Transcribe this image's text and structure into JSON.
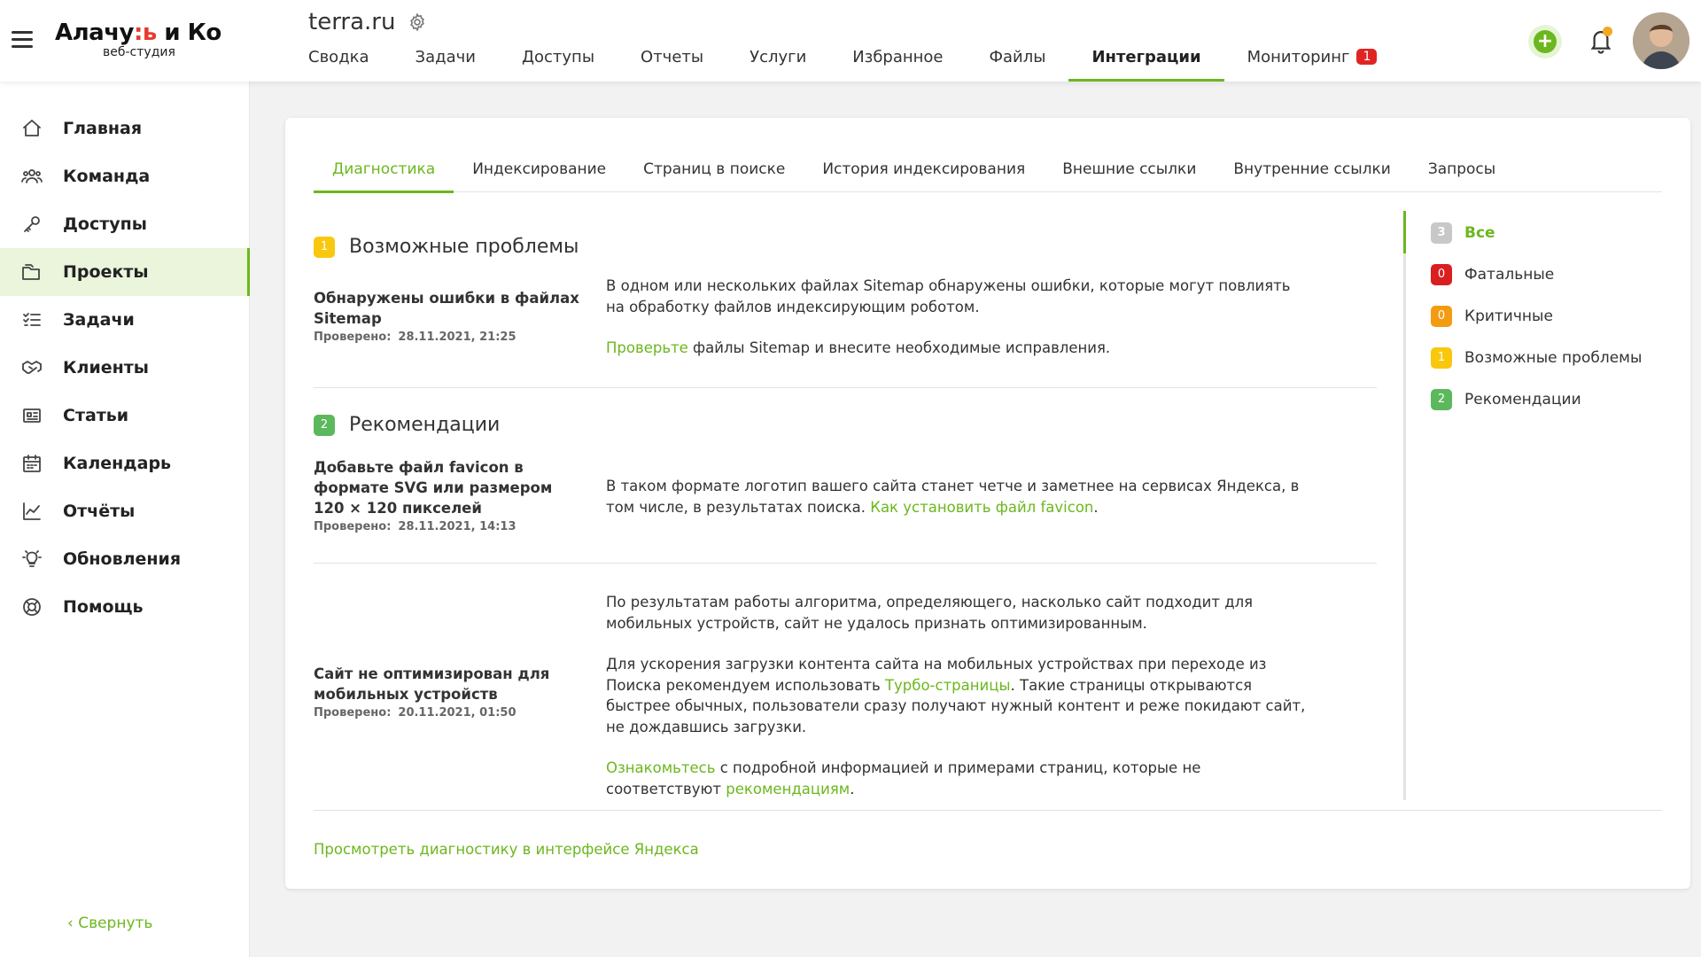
{
  "header": {
    "logo_main_a": "Алачу",
    "logo_main_accent": ":ь",
    "logo_main_b": " и Ко",
    "logo_sub": "веб-студия",
    "project_title": "terra.ru",
    "tabs": [
      {
        "label": "Сводка"
      },
      {
        "label": "Задачи"
      },
      {
        "label": "Доступы"
      },
      {
        "label": "Отчеты"
      },
      {
        "label": "Услуги"
      },
      {
        "label": "Избранное"
      },
      {
        "label": "Файлы"
      },
      {
        "label": "Интеграции",
        "active": true
      },
      {
        "label": "Мониторинг",
        "badge": "1"
      }
    ],
    "add_label": "+"
  },
  "sidebar": {
    "items": [
      {
        "label": "Главная",
        "icon": "home-icon"
      },
      {
        "label": "Команда",
        "icon": "team-icon"
      },
      {
        "label": "Доступы",
        "icon": "key-icon"
      },
      {
        "label": "Проекты",
        "icon": "folder-icon",
        "active": true
      },
      {
        "label": "Задачи",
        "icon": "tasks-icon"
      },
      {
        "label": "Клиенты",
        "icon": "handshake-icon"
      },
      {
        "label": "Статьи",
        "icon": "articles-icon"
      },
      {
        "label": "Календарь",
        "icon": "calendar-icon"
      },
      {
        "label": "Отчёты",
        "icon": "chart-icon"
      },
      {
        "label": "Обновления",
        "icon": "lightbulb-icon"
      },
      {
        "label": "Помощь",
        "icon": "lifebuoy-icon"
      }
    ],
    "collapse_label": "‹  Свернуть"
  },
  "subtabs": [
    {
      "label": "Диагностика",
      "active": true
    },
    {
      "label": "Индексирование"
    },
    {
      "label": "Страниц в поиске"
    },
    {
      "label": "История индексирования"
    },
    {
      "label": "Внешние ссылки"
    },
    {
      "label": "Внутренние ссылки"
    },
    {
      "label": "Запросы"
    }
  ],
  "sections": {
    "problems": {
      "badge": "1",
      "title": "Возможные проблемы"
    },
    "recommendations": {
      "badge": "2",
      "title": "Рекомендации"
    }
  },
  "issues": {
    "sitemap": {
      "title": "Обнаружены ошибки в файлах Sitemap",
      "checked_label": "Проверено:",
      "checked_value": "28.11.2021, 21:25",
      "p1": "В одном или нескольких файлах Sitemap обнаружены ошибки, которые могут повлиять на обработку файлов индексирующим роботом.",
      "p2_link": "Проверьте",
      "p2_rest": " файлы Sitemap и внесите необходимые исправления."
    },
    "favicon": {
      "title": "Добавьте файл favicon в формате SVG или размером 120 × 120 пикселей",
      "checked_label": "Проверено:",
      "checked_value": "28.11.2021, 14:13",
      "p1_text": "В таком формате логотип вашего сайта станет четче и заметнее на сервисах Яндекса, в том числе, в результатах поиска. ",
      "p1_link": "Как установить файл favicon",
      "p1_end": "."
    },
    "mobile": {
      "title": "Сайт не оптимизирован для мобильных устройств",
      "checked_label": "Проверено:",
      "checked_value": "20.11.2021, 01:50",
      "p1": "По результатам работы алгоритма, определяющего, насколько сайт подходит для мобильных устройств, сайт не удалось признать оптимизированным.",
      "p2_a": "Для ускорения загрузки контента сайта на мобильных устройствах при переходе из Поиска рекомендуем использовать ",
      "p2_link": "Турбо-страницы",
      "p2_b": ". Такие страницы открываются быстрее обычных, пользователи сразу получают нужный контент и реже покидают сайт, не дождавшись загрузки.",
      "p3_link1": "Ознакомьтесь",
      "p3_a": " с подробной информацией и примерами страниц, которые не соответствуют ",
      "p3_link2": "рекомендациям",
      "p3_end": "."
    }
  },
  "footer_link": "Просмотреть диагностику в интерфейсе Яндекса",
  "filters": [
    {
      "count": "3",
      "label": "Все",
      "color": "#c8c8c8",
      "active": true
    },
    {
      "count": "0",
      "label": "Фатальные",
      "color": "#d91f1f"
    },
    {
      "count": "0",
      "label": "Критичные",
      "color": "#f39c12"
    },
    {
      "count": "1",
      "label": "Возможные проблемы",
      "color": "#f9c80e"
    },
    {
      "count": "2",
      "label": "Рекомендации",
      "color": "#5cb85c"
    }
  ],
  "colors": {
    "accent": "#6cb71e",
    "badge_red": "#e02424"
  }
}
